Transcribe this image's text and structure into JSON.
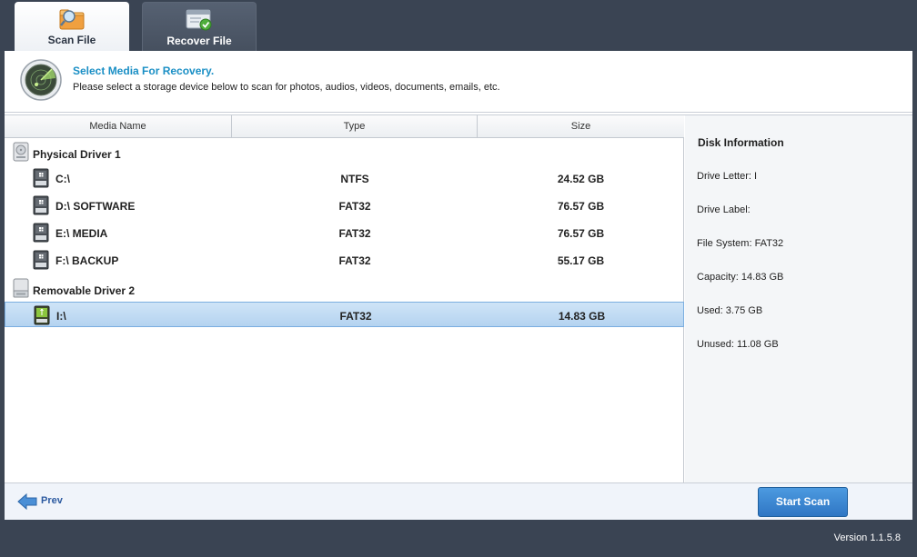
{
  "tabs": [
    {
      "label": "Scan File",
      "active": true,
      "icon": "folder-scan-icon"
    },
    {
      "label": "Recover File",
      "active": false,
      "icon": "recover-icon"
    }
  ],
  "header": {
    "title": "Select Media For Recovery.",
    "subtitle": "Please select a storage device below to scan for photos, audios, videos, documents, emails, etc.",
    "icon": "radar-scan-icon"
  },
  "table": {
    "columns": [
      "Media Name",
      "Type",
      "Size"
    ],
    "groups": [
      {
        "label": "Physical Driver 1",
        "icon": "hard-drive-icon",
        "rows": [
          {
            "name": "C:\\",
            "type": "NTFS",
            "size": "24.52 GB",
            "selected": false
          },
          {
            "name": "D:\\ SOFTWARE",
            "type": "FAT32",
            "size": "76.57 GB",
            "selected": false
          },
          {
            "name": "E:\\ MEDIA",
            "type": "FAT32",
            "size": "76.57 GB",
            "selected": false
          },
          {
            "name": "F:\\ BACKUP",
            "type": "FAT32",
            "size": "55.17 GB",
            "selected": false
          }
        ]
      },
      {
        "label": "Removable Driver 2",
        "icon": "removable-drive-icon",
        "rows": [
          {
            "name": "I:\\",
            "type": "FAT32",
            "size": "14.83 GB",
            "selected": true
          }
        ]
      }
    ]
  },
  "disk_info": {
    "title": "Disk Information",
    "drive_letter": "Drive Letter: I",
    "drive_label": "Drive Label:",
    "file_system": "File System: FAT32",
    "capacity": "Capacity: 14.83 GB",
    "used": "Used: 3.75 GB",
    "unused": "Unused: 11.08 GB"
  },
  "footer": {
    "prev_label": "Prev",
    "start_scan_label": "Start Scan"
  },
  "status": {
    "version": "Version 1.1.5.8"
  },
  "colors": {
    "dark_bar": "#3a4453",
    "accent_title": "#1a8fc5",
    "selection": "#b4d3f0",
    "button": "#2f76c4"
  }
}
